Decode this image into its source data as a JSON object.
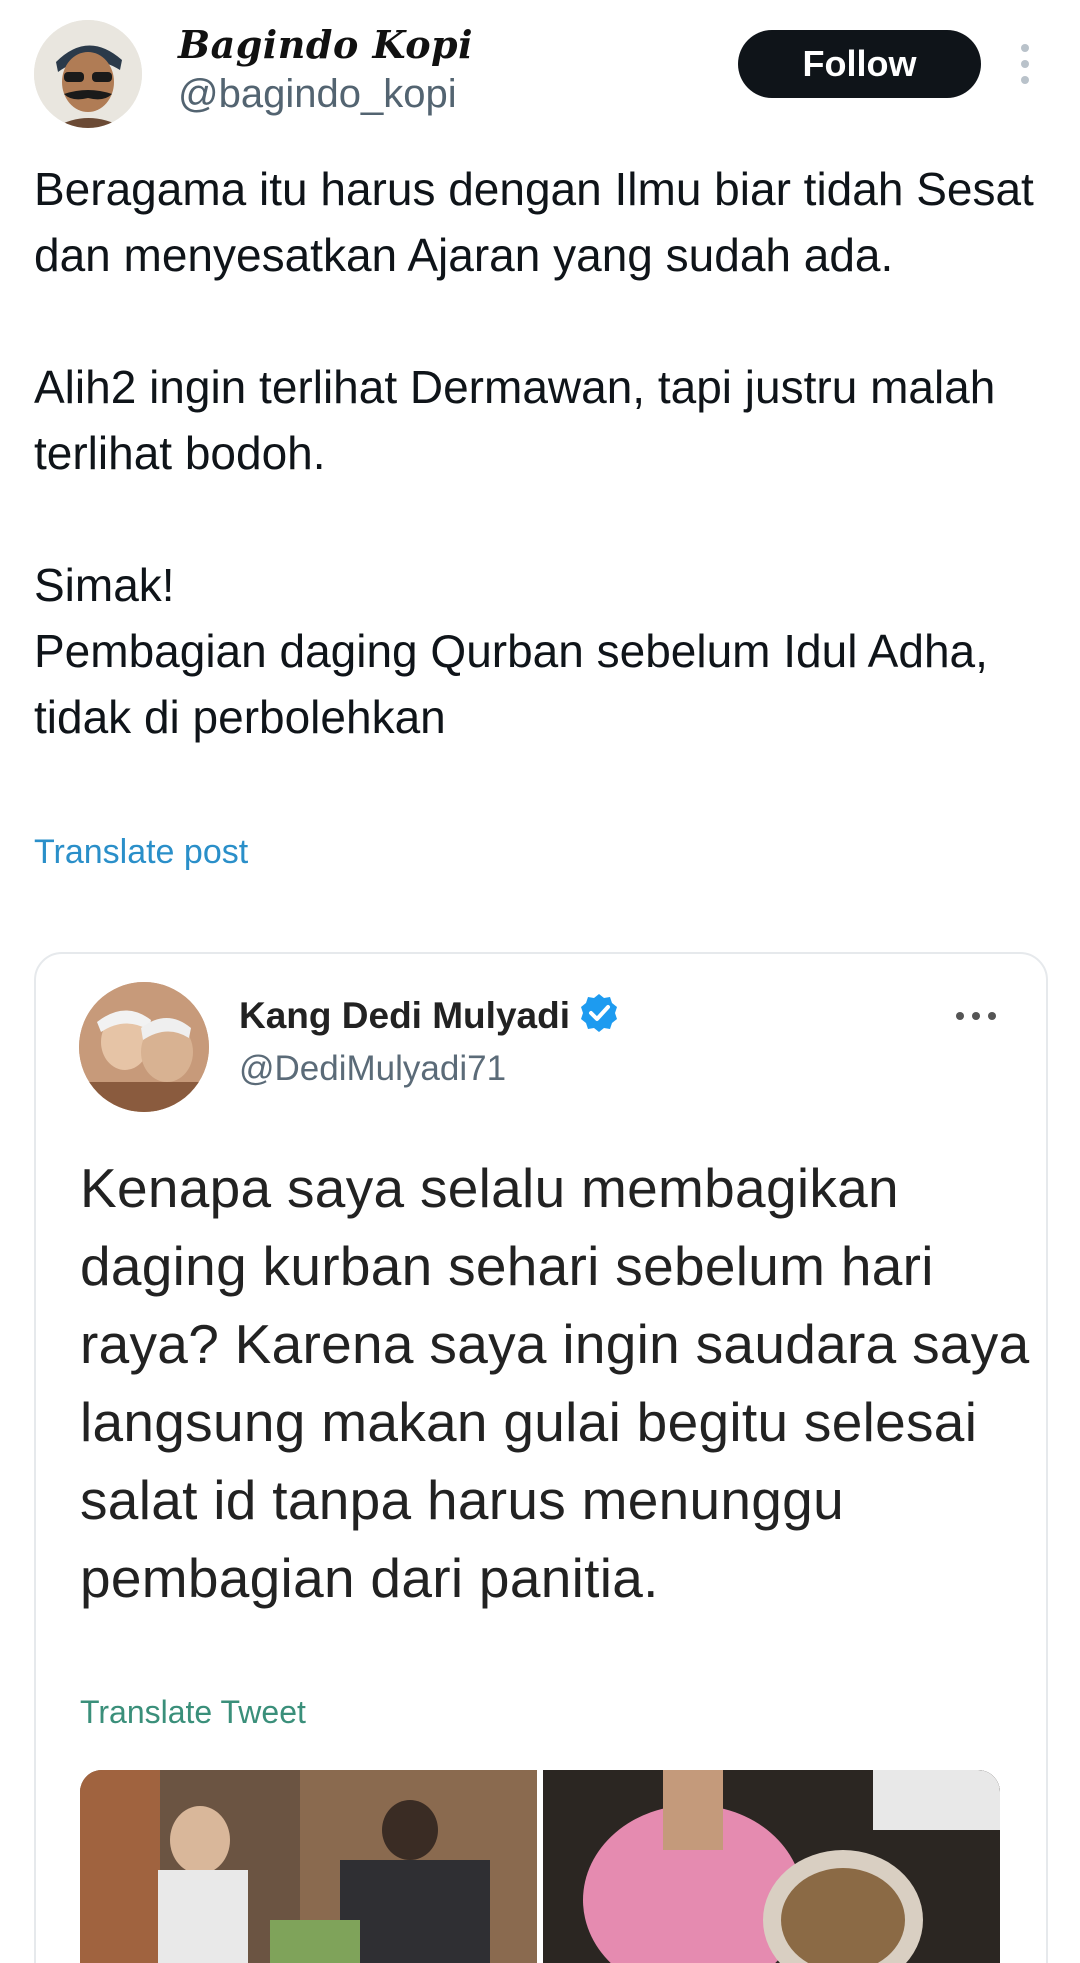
{
  "post": {
    "author": {
      "display_name": "Bagindo Kopi",
      "handle": "@bagindo_kopi"
    },
    "follow_label": "Follow",
    "paragraphs": [
      "Beragama itu harus dengan Ilmu biar tidah Sesat dan menyesatkan Ajaran yang sudah ada.",
      "Alih2 ingin terlihat Dermawan, tapi justru malah terlihat bodoh.",
      "Simak!\nPembagian daging Qurban sebelum Idul Adha, tidak di perbolehkan"
    ],
    "translate_label": "Translate post"
  },
  "quoted": {
    "author": {
      "display_name": "Kang Dedi Mulyadi",
      "handle": "@DediMulyadi71",
      "verified": true
    },
    "text": "Kenapa saya selalu membagikan daging kurban sehari sebelum hari raya? Karena saya ingin saudara saya langsung makan gulai begitu selesai salat id tanpa harus menunggu pembagian dari panitia.",
    "translate_label": "Translate Tweet",
    "media_count": 2
  },
  "colors": {
    "link": "#2a8fc9",
    "verified": "#1d9bf0",
    "follow_bg": "#0f1419",
    "follow_text": "#ffffff"
  },
  "icons": {
    "more_top": "more-vertical-icon",
    "more_quote": "more-horizontal-icon",
    "verified": "verified-badge-icon"
  }
}
